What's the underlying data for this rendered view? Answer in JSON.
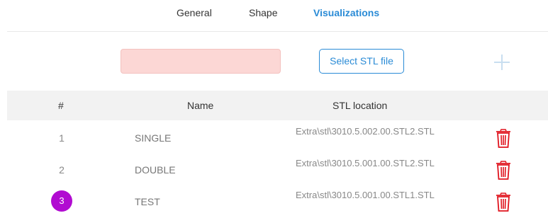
{
  "tabs": [
    {
      "label": "General",
      "active": false
    },
    {
      "label": "Shape",
      "active": false
    },
    {
      "label": "Visualizations",
      "active": true
    }
  ],
  "form": {
    "name_input_value": "",
    "name_input_placeholder": "",
    "select_stl_label": "Select STL file",
    "add_icon": "plus-icon"
  },
  "table": {
    "headers": {
      "number": "#",
      "name": "Name",
      "stl_location": "STL location"
    },
    "rows": [
      {
        "number": "1",
        "name": "SINGLE",
        "stl": "Extra\\stl\\3010.5.002.00.STL2.STL",
        "selected": false
      },
      {
        "number": "2",
        "name": "DOUBLE",
        "stl": "Extra\\stl\\3010.5.001.00.STL2.STL",
        "selected": false
      },
      {
        "number": "3",
        "name": "TEST",
        "stl": "Extra\\stl\\3010.5.001.00.STL1.STL",
        "selected": true
      }
    ]
  },
  "colors": {
    "accent": "#2a8bd6",
    "error_input_bg": "#fcd7d5",
    "selected_badge": "#b10bd1",
    "delete_icon": "#e0141e",
    "header_bg": "#f2f2f2"
  },
  "icons": {
    "delete": "trash-icon"
  }
}
